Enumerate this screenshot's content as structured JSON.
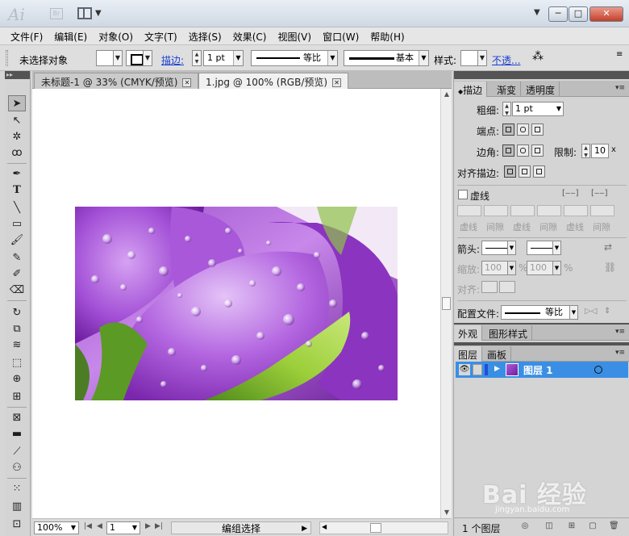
{
  "titlebar": {
    "logo": "Ai",
    "bridge": "Br",
    "window_buttons": [
      "─",
      "□",
      "✕"
    ]
  },
  "menu": [
    "文件(F)",
    "编辑(E)",
    "对象(O)",
    "文字(T)",
    "选择(S)",
    "效果(C)",
    "视图(V)",
    "窗口(W)",
    "帮助(H)"
  ],
  "control": {
    "selection_status": "未选择对象",
    "stroke_label": "描边:",
    "stroke_weight": "1 pt",
    "profile_label": "等比",
    "brush_label": "基本",
    "style_label": "样式:",
    "opacity_label": "不透..."
  },
  "document_tabs": [
    {
      "label": "未标题-1 @ 33% (CMYK/预览)",
      "active": false
    },
    {
      "label": "1.jpg @ 100% (RGB/预览)",
      "active": true
    }
  ],
  "statusbar": {
    "zoom": "100%",
    "artboard": "1",
    "status": "编组选择"
  },
  "stroke_panel": {
    "tabs": [
      "描边",
      "渐变",
      "透明度"
    ],
    "weight_label": "粗细:",
    "weight_value": "1 pt",
    "cap_label": "端点:",
    "corner_label": "边角:",
    "limit_label": "限制:",
    "limit_value": "10",
    "limit_unit": "x",
    "align_label": "对齐描边:",
    "dashed_label": "虚线",
    "dash_labels": [
      "虚线",
      "间隙",
      "虚线",
      "间隙",
      "虚线",
      "间隙"
    ],
    "arrow_label": "箭头:",
    "scale_label": "缩放:",
    "scale_values": [
      "100",
      "100"
    ],
    "percent": "%",
    "align_arrow_label": "对齐:",
    "profile_label": "配置文件:",
    "profile_value": "等比"
  },
  "appearance_tabs": [
    "外观",
    "图形样式"
  ],
  "layers_panel": {
    "tabs": [
      "图层",
      "画板"
    ],
    "layers": [
      {
        "name": "图层 1"
      }
    ],
    "count_label": "1 个图层"
  },
  "watermark": {
    "text": "Bai 经验",
    "sub": "jingyan.baidu.com"
  },
  "colors": {
    "selection_blue": "#3a8fe4",
    "panel_header": "#545454",
    "link_blue": "#1a3fd1"
  }
}
